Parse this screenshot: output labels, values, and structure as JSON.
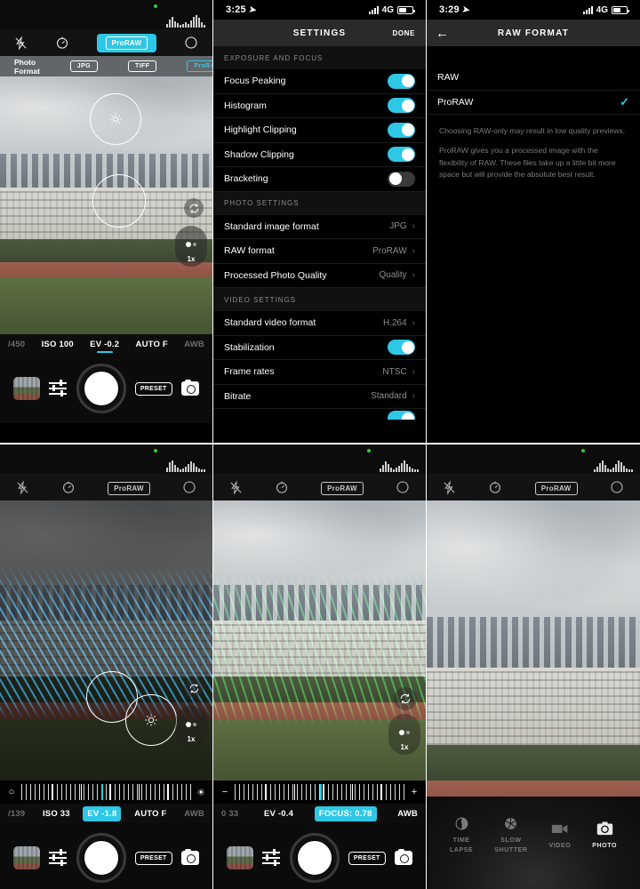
{
  "app": {
    "name": "Halide Camera"
  },
  "panels": {
    "top_left": {
      "name": "camera-photo-format",
      "topbar": {
        "histogram": "histogram",
        "rec_indicator": "rec-dot"
      },
      "controls": [
        {
          "name": "flash-off-icon",
          "label": "flash-off"
        },
        {
          "name": "timer-icon",
          "label": "timer"
        },
        {
          "name": "proraw-toggle",
          "label": "ProRAW",
          "active": true
        },
        {
          "name": "grid-circle-icon",
          "label": "focus-mode"
        }
      ],
      "format_strip": {
        "label": "Photo Format",
        "options": [
          {
            "label": "JPG",
            "selected": false
          },
          {
            "label": "TIFF",
            "selected": false
          },
          {
            "label": "ProRAW",
            "selected": true
          }
        ]
      },
      "viewfinder": {
        "zoom_label": "1x",
        "rotate_icon": "rotate-icon",
        "exposure_reticle": "sun-icon",
        "focus_reticle": "focus-circle"
      },
      "exposure_row": [
        {
          "label": "/450",
          "state": "dim"
        },
        {
          "label": "ISO 100",
          "state": "normal"
        },
        {
          "label": "EV -0.2",
          "state": "active"
        },
        {
          "label": "AUTO F",
          "state": "normal"
        },
        {
          "label": "AWB",
          "state": "dim"
        }
      ],
      "bottom_bar": {
        "gallery": "gallery-thumbnail",
        "adjust": "sliders-icon",
        "shutter": "shutter-button",
        "preset": "PRESET",
        "swap": "camera-swap-icon"
      }
    },
    "top_center": {
      "name": "settings-screen",
      "status": {
        "time": "3:25",
        "network": "4G"
      },
      "header": {
        "title": "SETTINGS",
        "done_label": "DONE"
      },
      "sections": [
        {
          "title": "EXPOSURE AND FOCUS",
          "rows": [
            {
              "label": "Focus Peaking",
              "type": "toggle",
              "on": true
            },
            {
              "label": "Histogram",
              "type": "toggle",
              "on": true
            },
            {
              "label": "Highlight Clipping",
              "type": "toggle",
              "on": true
            },
            {
              "label": "Shadow Clipping",
              "type": "toggle",
              "on": true
            },
            {
              "label": "Bracketing",
              "type": "toggle",
              "on": false
            }
          ]
        },
        {
          "title": "PHOTO SETTINGS",
          "rows": [
            {
              "label": "Standard image format",
              "type": "value",
              "value": "JPG"
            },
            {
              "label": "RAW format",
              "type": "value",
              "value": "ProRAW"
            },
            {
              "label": "Processed Photo Quality",
              "type": "value",
              "value": "Quality"
            }
          ]
        },
        {
          "title": "VIDEO SETTINGS",
          "rows": [
            {
              "label": "Standard video format",
              "type": "value",
              "value": "H.264"
            },
            {
              "label": "Stabilization",
              "type": "toggle",
              "on": true
            },
            {
              "label": "Frame rates",
              "type": "value",
              "value": "NTSC"
            },
            {
              "label": "Bitrate",
              "type": "value",
              "value": "Standard"
            }
          ]
        }
      ]
    },
    "top_right": {
      "name": "raw-format-screen",
      "status": {
        "time": "3:29",
        "network": "4G"
      },
      "header": {
        "title": "RAW FORMAT",
        "back_icon": "back-arrow-icon"
      },
      "options": [
        {
          "label": "RAW",
          "selected": false
        },
        {
          "label": "ProRAW",
          "selected": true
        }
      ],
      "notes": [
        "Choosing RAW-only may result in low quality previews.",
        "ProRAW gives you a processed image with the flexibility of RAW. These files take up a little bit more space but will provide the absolute best result."
      ]
    },
    "bottom_left": {
      "name": "camera-shadow-clipping",
      "controls": [
        {
          "name": "flash-off-icon",
          "label": "flash-off"
        },
        {
          "name": "timer-icon",
          "label": "timer"
        },
        {
          "name": "proraw-toggle",
          "label": "ProRAW",
          "active": false
        },
        {
          "name": "grid-circle-icon",
          "label": "focus-mode"
        }
      ],
      "viewfinder": {
        "zoom_label": "1x",
        "rotate_icon": "rotate-icon"
      },
      "slider": {
        "left_icon": "exposure-dot-icon",
        "right_icon": "brightness-icon"
      },
      "exposure_row": [
        {
          "label": "/139",
          "state": "dim"
        },
        {
          "label": "ISO 33",
          "state": "normal"
        },
        {
          "label": "EV -1.8",
          "state": "highlight"
        },
        {
          "label": "AUTO F",
          "state": "normal"
        },
        {
          "label": "AWB",
          "state": "dim"
        }
      ],
      "bottom_bar": {
        "preset": "PRESET"
      }
    },
    "bottom_center": {
      "name": "camera-focus-peaking",
      "controls": [
        {
          "name": "flash-off-icon",
          "label": "flash-off"
        },
        {
          "name": "timer-icon",
          "label": "timer"
        },
        {
          "name": "proraw-toggle",
          "label": "ProRAW",
          "active": false
        },
        {
          "name": "grid-circle-icon",
          "label": "focus-mode"
        }
      ],
      "viewfinder": {
        "zoom_label": "1x",
        "rotate_icon": "rotate-icon"
      },
      "slider": {
        "left_icon": "minus-icon",
        "right_icon": "plus-icon"
      },
      "exposure_row": [
        {
          "label": "0 33",
          "state": "dim"
        },
        {
          "label": "EV -0.4",
          "state": "normal"
        },
        {
          "label": "FOCUS: 0.78",
          "state": "highlight"
        },
        {
          "label": "AWB",
          "state": "normal"
        }
      ],
      "bottom_bar": {
        "preset": "PRESET"
      }
    },
    "bottom_right": {
      "name": "camera-mode-selector",
      "controls": [
        {
          "name": "flash-off-icon",
          "label": "flash-off"
        },
        {
          "name": "timer-icon",
          "label": "timer"
        },
        {
          "name": "proraw-toggle",
          "label": "ProRAW",
          "active": false
        },
        {
          "name": "grid-circle-icon",
          "label": "focus-mode"
        }
      ],
      "modes": [
        {
          "label": "TIME\nLAPSE",
          "line1": "TIME",
          "line2": "LAPSE",
          "icon": "time-lapse-icon",
          "selected": false
        },
        {
          "label": "SLOW SHUTTER",
          "line1": "SLOW",
          "line2": "SHUTTER",
          "icon": "aperture-icon",
          "selected": false
        },
        {
          "label": "VIDEO",
          "line1": "VIDEO",
          "line2": "",
          "icon": "video-icon",
          "selected": false
        },
        {
          "label": "PHOTO",
          "line1": "PHOTO",
          "line2": "",
          "icon": "photo-icon",
          "selected": true
        }
      ]
    }
  },
  "colors": {
    "accent": "#2ec8e6",
    "background": "#000000",
    "peaking_green": "#1eeb3c",
    "clipping_blue": "#28b4ff"
  }
}
